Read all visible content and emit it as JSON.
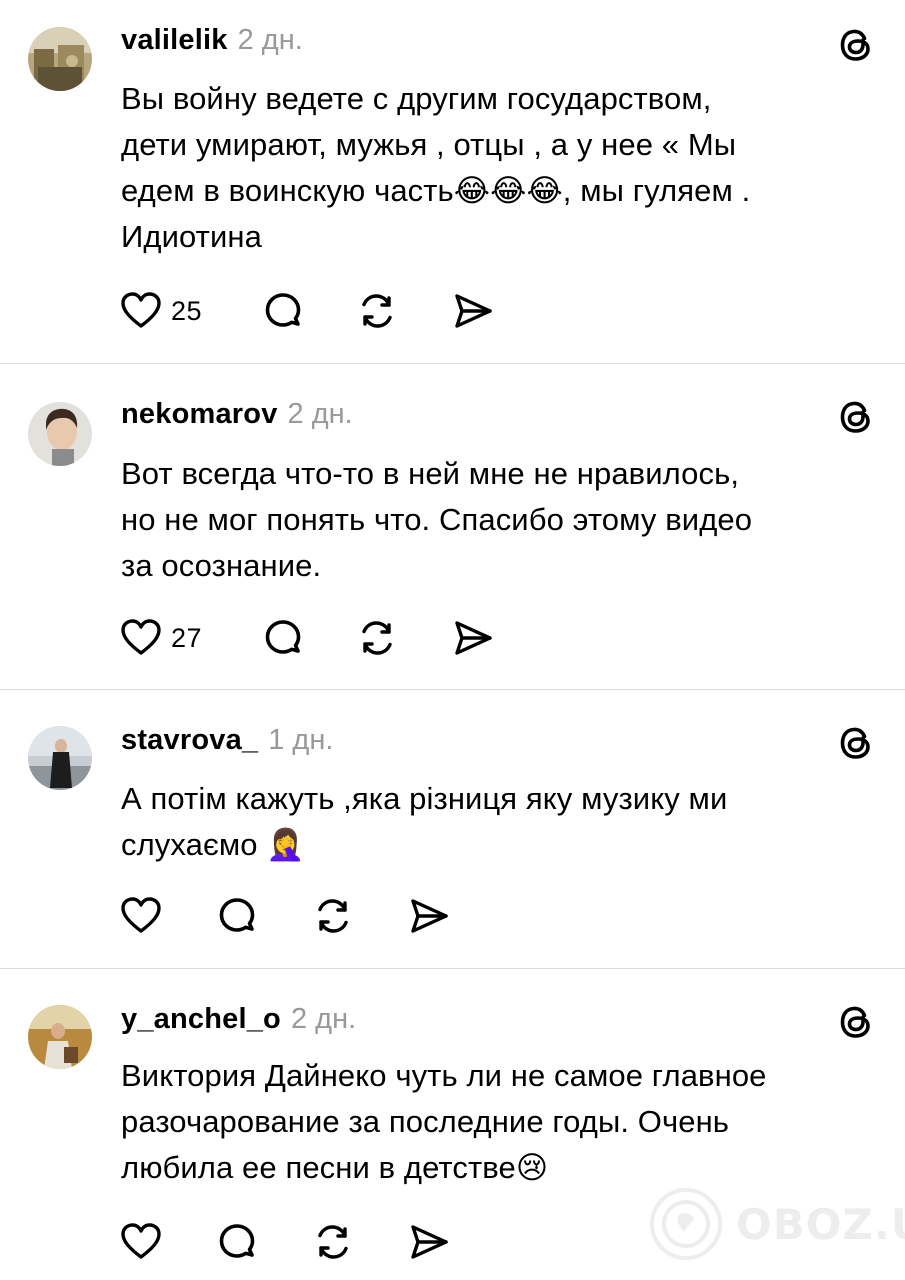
{
  "posts": [
    {
      "username": "valilelik",
      "time": "2 дн.",
      "lines": [
        "Вы войну ведете с другим государством,",
        "дети умирают, мужья , отцы , а у нее « Мы",
        "едем в воинскую часть😂😂😂, мы гуляем .",
        "Идиотина"
      ],
      "likes": "25"
    },
    {
      "username": "nekomarov",
      "time": "2 дн.",
      "lines": [
        "Вот всегда что-то в ней мне не нравилось,",
        "но не мог понять что. Спасибо этому видео",
        "за осознание."
      ],
      "likes": "27"
    },
    {
      "username": "stavrova_",
      "time": "1 дн.",
      "lines": [
        "А потім кажуть ,яка різниця яку музику ми",
        "слухаємо 🤦‍♀️"
      ],
      "likes": ""
    },
    {
      "username": "y_anchel_o",
      "time": "2 дн.",
      "lines": [
        "Виктория Дайнеко чуть ли не самое главное",
        "разочарование за последние годы. Очень",
        "любила ее песни в детстве😢"
      ],
      "likes": ""
    }
  ],
  "icons": {
    "like": "heart-icon",
    "reply": "comment-bubble-icon",
    "repost": "repost-icon",
    "share": "send-icon",
    "platform": "threads-logo-icon"
  },
  "watermark": {
    "text": "OBOZ.UA"
  },
  "colors": {
    "text": "#000000",
    "muted": "#999999",
    "divider": "#dcdcdc",
    "background": "#ffffff"
  }
}
